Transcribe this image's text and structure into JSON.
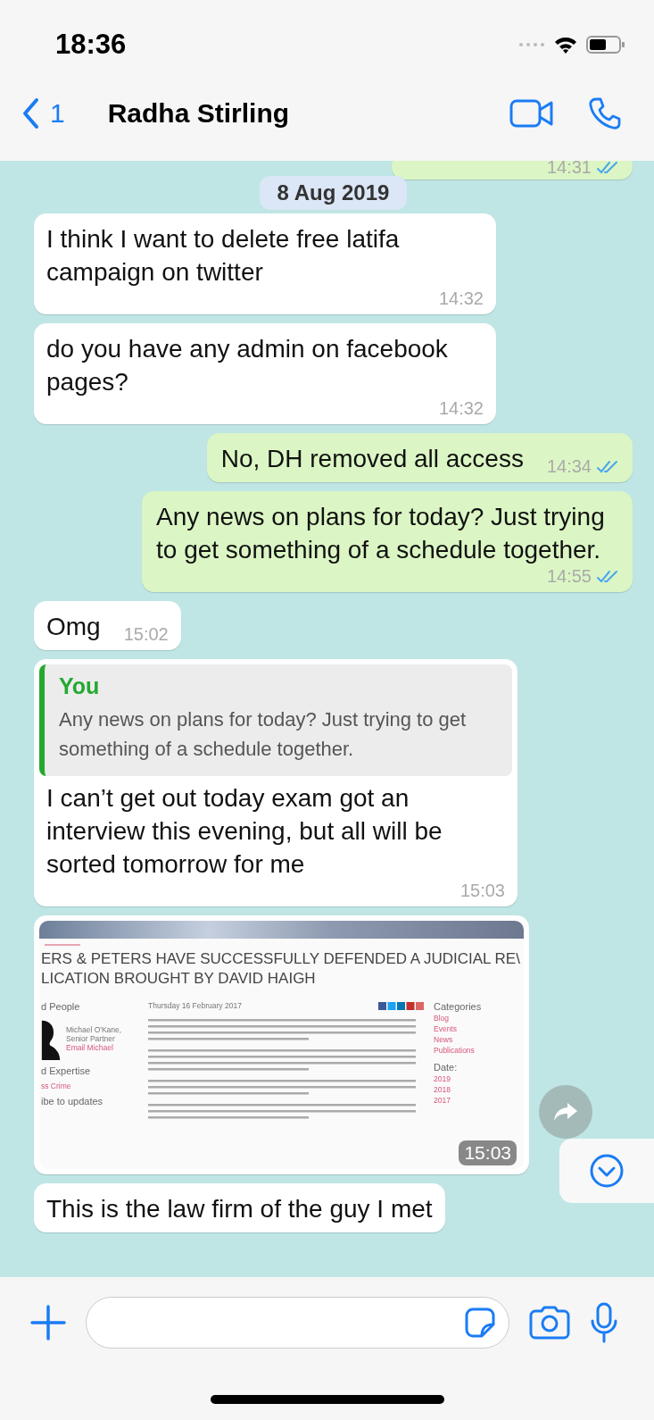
{
  "status_bar": {
    "time": "18:36"
  },
  "header": {
    "back_count": "1",
    "title": "Radha Stirling"
  },
  "messages": [
    {
      "kind": "text",
      "outgoing": true,
      "time": "14:31",
      "read": true
    },
    {
      "kind": "date",
      "text": "8 Aug 2019"
    },
    {
      "kind": "text",
      "outgoing": false,
      "text": "I think I want to delete free latifa campaign on twitter",
      "time": "14:32"
    },
    {
      "kind": "text",
      "outgoing": false,
      "text": "do you have any admin on facebook pages?",
      "time": "14:32"
    },
    {
      "kind": "text",
      "outgoing": true,
      "text": "No, DH removed all access",
      "time": "14:34",
      "read": true
    },
    {
      "kind": "text",
      "outgoing": true,
      "text": "Any news on plans for today? Just trying to get something of a schedule together.",
      "time": "14:55",
      "read": true
    },
    {
      "kind": "text",
      "outgoing": false,
      "text": "Omg",
      "time": "15:02"
    },
    {
      "kind": "reply",
      "outgoing": false,
      "quote_author": "You",
      "quote_text": "Any news on plans for today? Just trying to get something of a schedule together.",
      "text": "I can’t get out today exam got an interview this evening, but all will be sorted tomorrow for me",
      "time": "15:03"
    },
    {
      "kind": "image",
      "outgoing": false,
      "time": "15:03",
      "page": {
        "headline_1": "ERS & PETERS HAVE SUCCESSFULLY DEFENDED A JUDICIAL RE\\",
        "headline_2": "LICATION BROUGHT BY DAVID HAIGH",
        "side_labels": [
          "d People",
          "d Expertise",
          "ss Crime",
          "ibe to updates"
        ],
        "person_name": "Michael O'Kane, Senior Partner",
        "person_email": "Email Michael",
        "date": "Thursday 16 February 2017",
        "categories_title": "Categories",
        "categories": [
          "Blog",
          "Events",
          "News",
          "Publications"
        ],
        "date_title": "Date:",
        "years": [
          "2019",
          "2018",
          "2017"
        ]
      }
    },
    {
      "kind": "text",
      "outgoing": false,
      "text": "This is the law firm of the guy I met"
    }
  ]
}
